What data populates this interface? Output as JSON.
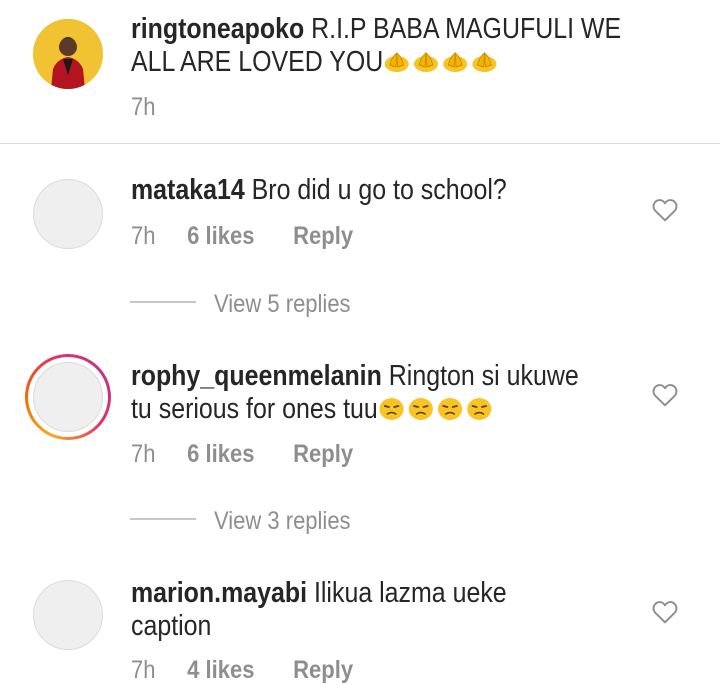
{
  "caption": {
    "username": "ringtoneapoko",
    "text_line1": "R.I.P BABA MAGUFULI WE",
    "text_line2": "ALL ARE LOVED YOU",
    "emoji": "folded-hands-emoji",
    "emoji_count": 4,
    "time": "7h"
  },
  "comments": [
    {
      "username": "mataka14",
      "text_line1": "Bro did u go to school?",
      "text_line2": "",
      "time": "7h",
      "likes": "6 likes",
      "reply": "Reply",
      "view_replies": "View 5 replies",
      "has_story": false
    },
    {
      "username": "rophy_queenmelanin",
      "text_line1": "Rington si ukuwe",
      "text_line2": "tu serious for ones tuu",
      "emoji": "unamused-face-emoji",
      "emoji_count": 4,
      "time": "7h",
      "likes": "6 likes",
      "reply": "Reply",
      "view_replies": "View 3 replies",
      "has_story": true
    },
    {
      "username": "marion.mayabi",
      "text_line1": "Ilikua lazma ueke",
      "text_line2": "caption",
      "time": "7h",
      "likes": "4 likes",
      "reply": "Reply",
      "has_story": false
    }
  ],
  "colors": {
    "text": "#262626",
    "secondary": "#8e8e8e",
    "avatar_placeholder": "#efefef",
    "emoji_yellow": "#f7c325"
  }
}
